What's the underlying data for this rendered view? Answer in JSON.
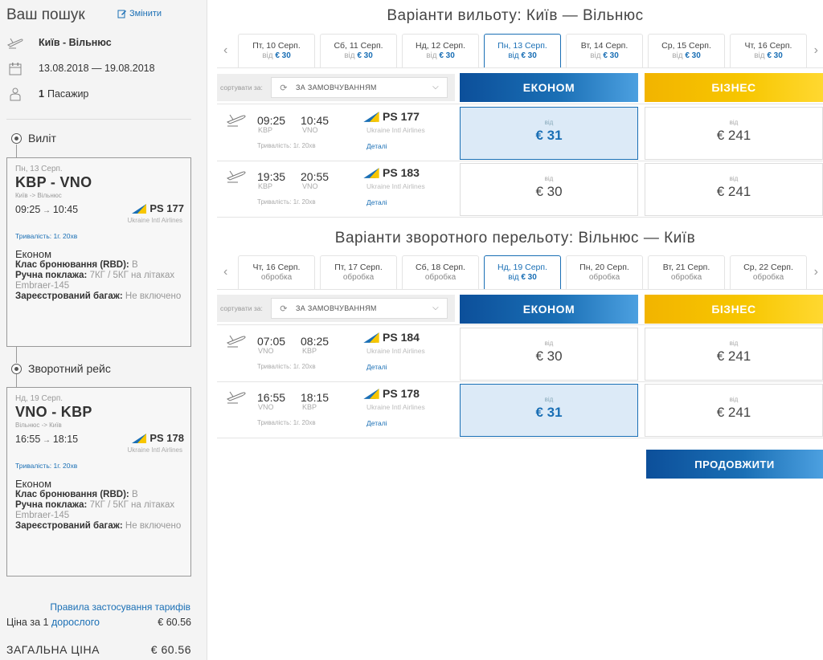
{
  "search": {
    "title": "Ваш пошук",
    "edit_label": "Змінити",
    "route": "Київ - Вільнюс",
    "dates": "13.08.2018 — 19.08.2018",
    "passengers_count": "1",
    "passengers_label": "Пасажир"
  },
  "outbound_segment": {
    "heading": "Виліт",
    "date": "Пн, 13 Серп.",
    "route": "KBP - VNO",
    "cities": "Київ -> Вільнюс",
    "dep": "09:25",
    "arr": "10:45",
    "flight": "PS 177",
    "airline": "Ukraine Intl Airlines",
    "duration": "Тривалість: 1г. 20хв",
    "class": "Економ",
    "rbd_label": "Клас бронювання (RBD):",
    "rbd_value": "B",
    "hand_label": "Ручна поклажа:",
    "hand_value": "7КГ / 5КГ на літаках Embraer-145",
    "bag_label": "Зареєстрований багаж:",
    "bag_value": "Не включено"
  },
  "return_segment": {
    "heading": "Зворотний рейс",
    "date": "Нд, 19 Серп.",
    "route": "VNO - KBP",
    "cities": "Вільнюс -> Київ",
    "dep": "16:55",
    "arr": "18:15",
    "flight": "PS 178",
    "airline": "Ukraine Intl Airlines",
    "duration": "Тривалість: 1г. 20хв",
    "class": "Економ",
    "rbd_label": "Клас бронювання (RBD):",
    "rbd_value": "B",
    "hand_label": "Ручна поклажа:",
    "hand_value": "7КГ / 5КГ на літаках Embraer-145",
    "bag_label": "Зареєстрований багаж:",
    "bag_value": "Не включено"
  },
  "pricing": {
    "fare_rules": "Правила застосування тарифів",
    "adult_prefix": "Ціна за",
    "adult_count": "1",
    "adult_link": "дорослого",
    "adult_price": "€ 60.56",
    "total_label": "ЗАГАЛЬНА ЦІНА",
    "total_price": "€ 60.56"
  },
  "outbound": {
    "title": "Варіанти вильоту: Київ — Вільнюс",
    "dates": [
      {
        "day": "Пт, 10 Серп.",
        "price_prefix": "від",
        "price": "€ 30"
      },
      {
        "day": "Сб, 11 Серп.",
        "price_prefix": "від",
        "price": "€ 30"
      },
      {
        "day": "Нд, 12 Серп.",
        "price_prefix": "від",
        "price": "€ 30"
      },
      {
        "day": "Пн, 13 Серп.",
        "price_prefix": "від",
        "price": "€ 30"
      },
      {
        "day": "Вт, 14 Серп.",
        "price_prefix": "від",
        "price": "€ 30"
      },
      {
        "day": "Ср, 15 Серп.",
        "price_prefix": "від",
        "price": "€ 30"
      },
      {
        "day": "Чт, 16 Серп.",
        "price_prefix": "від",
        "price": "€ 30"
      }
    ],
    "sort_label": "сортувати за:",
    "sort_value": "ЗА ЗАМОВЧУВАННЯМ",
    "economy": "ЕКОНОМ",
    "business": "БІЗНЕС",
    "flights": [
      {
        "dep": "09:25",
        "arr": "10:45",
        "from": "KBP",
        "to": "VNO",
        "duration": "Тривалість: 1г. 20хв",
        "flight": "PS 177",
        "airline": "Ukraine Intl Airlines",
        "details": "Деталі",
        "eco_from": "від",
        "eco_price": "€ 31",
        "bus_from": "від",
        "bus_price": "€ 241"
      },
      {
        "dep": "19:35",
        "arr": "20:55",
        "from": "KBP",
        "to": "VNO",
        "duration": "Тривалість: 1г. 20хв",
        "flight": "PS 183",
        "airline": "Ukraine Intl Airlines",
        "details": "Деталі",
        "eco_from": "від",
        "eco_price": "€ 30",
        "bus_from": "від",
        "bus_price": "€ 241"
      }
    ]
  },
  "inbound": {
    "title": "Варіанти зворотного перельоту: Вільнюс — Київ",
    "dates": [
      {
        "day": "Чт, 16 Серп.",
        "price_prefix": "",
        "price": "обробка"
      },
      {
        "day": "Пт, 17 Серп.",
        "price_prefix": "",
        "price": "обробка"
      },
      {
        "day": "Сб, 18 Серп.",
        "price_prefix": "",
        "price": "обробка"
      },
      {
        "day": "Нд, 19 Серп.",
        "price_prefix": "від",
        "price": "€ 30"
      },
      {
        "day": "Пн, 20 Серп.",
        "price_prefix": "",
        "price": "обробка"
      },
      {
        "day": "Вт, 21 Серп.",
        "price_prefix": "",
        "price": "обробка"
      },
      {
        "day": "Ср, 22 Серп.",
        "price_prefix": "",
        "price": "обробка"
      }
    ],
    "sort_label": "сортувати за:",
    "sort_value": "ЗА ЗАМОВЧУВАННЯМ",
    "economy": "ЕКОНОМ",
    "business": "БІЗНЕС",
    "flights": [
      {
        "dep": "07:05",
        "arr": "08:25",
        "from": "VNO",
        "to": "KBP",
        "duration": "Тривалість: 1г. 20хв",
        "flight": "PS 184",
        "airline": "Ukraine Intl Airlines",
        "details": "Деталі",
        "eco_from": "від",
        "eco_price": "€ 30",
        "bus_from": "від",
        "bus_price": "€ 241"
      },
      {
        "dep": "16:55",
        "arr": "18:15",
        "from": "VNO",
        "to": "KBP",
        "duration": "Тривалість: 1г. 20хв",
        "flight": "PS 178",
        "airline": "Ukraine Intl Airlines",
        "details": "Деталі",
        "eco_from": "від",
        "eco_price": "€ 31",
        "bus_from": "від",
        "bus_price": "€ 241"
      }
    ]
  },
  "continue_label": "ПРОДОВЖИТИ",
  "colors": {
    "brand_blue": "#1a6fb5",
    "business_yellow": "#f7c600"
  }
}
